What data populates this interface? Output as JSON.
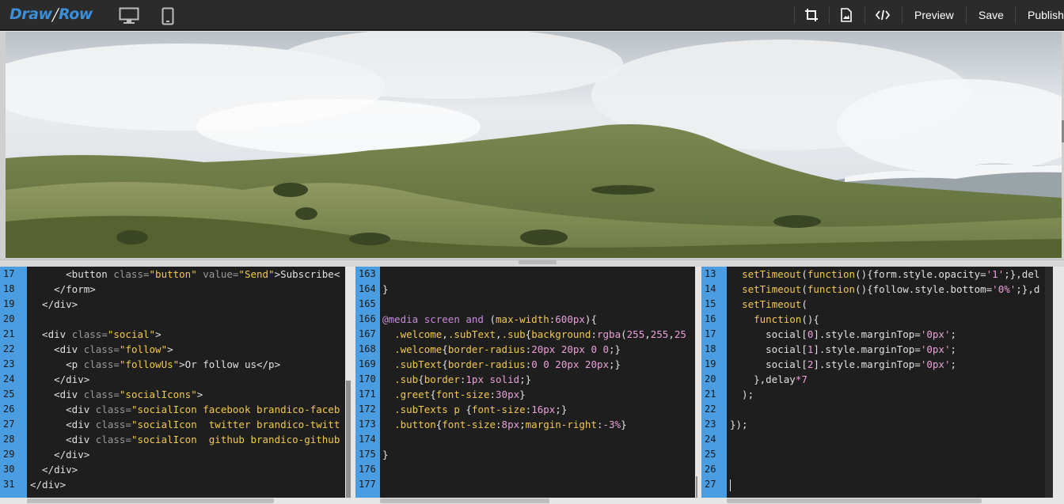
{
  "app": {
    "logo_left": "Draw",
    "logo_right": "Row"
  },
  "toolbar": {
    "devices": [
      "desktop-icon",
      "mobile-icon"
    ],
    "icons": [
      "crop-icon",
      "image-icon",
      "code-icon"
    ],
    "preview_label": "Preview",
    "save_label": "Save",
    "publish_label": "Publish"
  },
  "preview": {
    "sky_color": "#dfe3e8",
    "hill_color": "#6f7c4a"
  },
  "html_editor": {
    "line_numbers": [
      "17",
      "18",
      "19",
      "20",
      "21",
      "22",
      "23",
      "24",
      "25",
      "26",
      "27",
      "28",
      "29",
      "30",
      "31"
    ],
    "lines": [
      [
        {
          "c": "t",
          "v": "      <button "
        },
        {
          "c": "a",
          "v": "class="
        },
        {
          "c": "s",
          "v": "\"button\""
        },
        {
          "c": "t",
          "v": " "
        },
        {
          "c": "a",
          "v": "value="
        },
        {
          "c": "s",
          "v": "\"Send\""
        },
        {
          "c": "t",
          "v": ">Subscribe<"
        }
      ],
      [
        {
          "c": "t",
          "v": "    </form>"
        }
      ],
      [
        {
          "c": "t",
          "v": "  </div>"
        }
      ],
      [
        {
          "c": "t",
          "v": ""
        }
      ],
      [
        {
          "c": "t",
          "v": "  <div "
        },
        {
          "c": "a",
          "v": "class="
        },
        {
          "c": "s",
          "v": "\"social\""
        },
        {
          "c": "t",
          "v": ">"
        }
      ],
      [
        {
          "c": "t",
          "v": "    <div "
        },
        {
          "c": "a",
          "v": "class="
        },
        {
          "c": "s",
          "v": "\"follow\""
        },
        {
          "c": "t",
          "v": ">"
        }
      ],
      [
        {
          "c": "t",
          "v": "      <p "
        },
        {
          "c": "a",
          "v": "class="
        },
        {
          "c": "s",
          "v": "\"followUs\""
        },
        {
          "c": "t",
          "v": ">Or follow us</p>"
        }
      ],
      [
        {
          "c": "t",
          "v": "    </div>"
        }
      ],
      [
        {
          "c": "t",
          "v": "    <div "
        },
        {
          "c": "a",
          "v": "class="
        },
        {
          "c": "s",
          "v": "\"socialIcons\""
        },
        {
          "c": "t",
          "v": ">"
        }
      ],
      [
        {
          "c": "t",
          "v": "      <div "
        },
        {
          "c": "a",
          "v": "class="
        },
        {
          "c": "s",
          "v": "\"socialIcon facebook brandico-faceb"
        }
      ],
      [
        {
          "c": "t",
          "v": "      <div "
        },
        {
          "c": "a",
          "v": "class="
        },
        {
          "c": "s",
          "v": "\"socialIcon  twitter brandico-twitt"
        }
      ],
      [
        {
          "c": "t",
          "v": "      <div "
        },
        {
          "c": "a",
          "v": "class="
        },
        {
          "c": "s",
          "v": "\"socialIcon  github brandico-github"
        }
      ],
      [
        {
          "c": "t",
          "v": "    </div>"
        }
      ],
      [
        {
          "c": "t",
          "v": "  </div>"
        }
      ],
      [
        {
          "c": "t",
          "v": "</div>"
        }
      ]
    ]
  },
  "css_editor": {
    "line_numbers": [
      "163",
      "164",
      "165",
      "166",
      "167",
      "168",
      "169",
      "170",
      "171",
      "172",
      "173",
      "174",
      "175",
      "176",
      "177"
    ],
    "lines": [
      [
        {
          "c": "plain",
          "v": ""
        }
      ],
      [
        {
          "c": "plain",
          "v": "}"
        }
      ],
      [
        {
          "c": "plain",
          "v": ""
        }
      ],
      [
        {
          "c": "at",
          "v": "@media"
        },
        {
          "c": "plain",
          "v": " "
        },
        {
          "c": "at",
          "v": "screen"
        },
        {
          "c": "plain",
          "v": " "
        },
        {
          "c": "at",
          "v": "and"
        },
        {
          "c": "plain",
          "v": " ("
        },
        {
          "c": "prop",
          "v": "max-width"
        },
        {
          "c": "plain",
          "v": ":"
        },
        {
          "c": "num",
          "v": "600px"
        },
        {
          "c": "plain",
          "v": "){"
        }
      ],
      [
        {
          "c": "plain",
          "v": "  "
        },
        {
          "c": "sel",
          "v": ".welcome"
        },
        {
          "c": "plain",
          "v": ","
        },
        {
          "c": "sel",
          "v": ".subText"
        },
        {
          "c": "plain",
          "v": ","
        },
        {
          "c": "sel",
          "v": ".sub"
        },
        {
          "c": "plain",
          "v": "{"
        },
        {
          "c": "prop",
          "v": "background"
        },
        {
          "c": "plain",
          "v": ":"
        },
        {
          "c": "num",
          "v": "rgba"
        },
        {
          "c": "plain",
          "v": "("
        },
        {
          "c": "num",
          "v": "255"
        },
        {
          "c": "plain",
          "v": ","
        },
        {
          "c": "num",
          "v": "255"
        },
        {
          "c": "plain",
          "v": ","
        },
        {
          "c": "num",
          "v": "25"
        }
      ],
      [
        {
          "c": "plain",
          "v": "  "
        },
        {
          "c": "sel",
          "v": ".welcome"
        },
        {
          "c": "plain",
          "v": "{"
        },
        {
          "c": "prop",
          "v": "border-radius"
        },
        {
          "c": "plain",
          "v": ":"
        },
        {
          "c": "num",
          "v": "20px 20px 0 0"
        },
        {
          "c": "plain",
          "v": ";}"
        }
      ],
      [
        {
          "c": "plain",
          "v": "  "
        },
        {
          "c": "sel",
          "v": ".subText"
        },
        {
          "c": "plain",
          "v": "{"
        },
        {
          "c": "prop",
          "v": "border-radius"
        },
        {
          "c": "plain",
          "v": ":"
        },
        {
          "c": "num",
          "v": "0 0 20px 20px"
        },
        {
          "c": "plain",
          "v": ";}"
        }
      ],
      [
        {
          "c": "plain",
          "v": "  "
        },
        {
          "c": "sel",
          "v": ".sub"
        },
        {
          "c": "plain",
          "v": "{"
        },
        {
          "c": "prop",
          "v": "border"
        },
        {
          "c": "plain",
          "v": ":"
        },
        {
          "c": "num",
          "v": "1px solid"
        },
        {
          "c": "plain",
          "v": ";}"
        }
      ],
      [
        {
          "c": "plain",
          "v": "  "
        },
        {
          "c": "sel",
          "v": ".greet"
        },
        {
          "c": "plain",
          "v": "{"
        },
        {
          "c": "prop",
          "v": "font-size"
        },
        {
          "c": "plain",
          "v": ":"
        },
        {
          "c": "num",
          "v": "30px"
        },
        {
          "c": "plain",
          "v": "}"
        }
      ],
      [
        {
          "c": "plain",
          "v": "  "
        },
        {
          "c": "sel",
          "v": ".subTexts p"
        },
        {
          "c": "plain",
          "v": " {"
        },
        {
          "c": "prop",
          "v": "font-size"
        },
        {
          "c": "plain",
          "v": ":"
        },
        {
          "c": "num",
          "v": "16px"
        },
        {
          "c": "plain",
          "v": ";}"
        }
      ],
      [
        {
          "c": "plain",
          "v": "  "
        },
        {
          "c": "sel",
          "v": ".button"
        },
        {
          "c": "plain",
          "v": "{"
        },
        {
          "c": "prop",
          "v": "font-size"
        },
        {
          "c": "plain",
          "v": ":"
        },
        {
          "c": "num",
          "v": "8px"
        },
        {
          "c": "plain",
          "v": ";"
        },
        {
          "c": "prop",
          "v": "margin-right"
        },
        {
          "c": "plain",
          "v": ":"
        },
        {
          "c": "num",
          "v": "-3%"
        },
        {
          "c": "plain",
          "v": "}"
        }
      ],
      [
        {
          "c": "plain",
          "v": ""
        }
      ],
      [
        {
          "c": "plain",
          "v": "}"
        }
      ],
      [
        {
          "c": "plain",
          "v": ""
        }
      ],
      [
        {
          "c": "plain",
          "v": ""
        }
      ]
    ]
  },
  "js_editor": {
    "line_numbers": [
      "13",
      "14",
      "15",
      "16",
      "17",
      "18",
      "19",
      "20",
      "21",
      "22",
      "23",
      "24",
      "25",
      "26",
      "27"
    ],
    "lines": [
      [
        {
          "c": "plain",
          "v": "  "
        },
        {
          "c": "fn",
          "v": "setTimeout"
        },
        {
          "c": "plain",
          "v": "("
        },
        {
          "c": "fn",
          "v": "function"
        },
        {
          "c": "plain",
          "v": "(){form.style.opacity="
        },
        {
          "c": "str",
          "v": "'1'"
        },
        {
          "c": "plain",
          "v": ";},del"
        }
      ],
      [
        {
          "c": "plain",
          "v": "  "
        },
        {
          "c": "fn",
          "v": "setTimeout"
        },
        {
          "c": "plain",
          "v": "("
        },
        {
          "c": "fn",
          "v": "function"
        },
        {
          "c": "plain",
          "v": "(){follow.style.bottom="
        },
        {
          "c": "str",
          "v": "'0%'"
        },
        {
          "c": "plain",
          "v": ";},d"
        }
      ],
      [
        {
          "c": "plain",
          "v": "  "
        },
        {
          "c": "fn",
          "v": "setTimeout"
        },
        {
          "c": "plain",
          "v": "("
        }
      ],
      [
        {
          "c": "plain",
          "v": "    "
        },
        {
          "c": "fn",
          "v": "function"
        },
        {
          "c": "plain",
          "v": "(){"
        }
      ],
      [
        {
          "c": "plain",
          "v": "      social["
        },
        {
          "c": "num",
          "v": "0"
        },
        {
          "c": "plain",
          "v": "].style.marginTop="
        },
        {
          "c": "str",
          "v": "'0px'"
        },
        {
          "c": "plain",
          "v": ";"
        }
      ],
      [
        {
          "c": "plain",
          "v": "      social["
        },
        {
          "c": "num",
          "v": "1"
        },
        {
          "c": "plain",
          "v": "].style.marginTop="
        },
        {
          "c": "str",
          "v": "'0px'"
        },
        {
          "c": "plain",
          "v": ";"
        }
      ],
      [
        {
          "c": "plain",
          "v": "      social["
        },
        {
          "c": "num",
          "v": "2"
        },
        {
          "c": "plain",
          "v": "].style.marginTop="
        },
        {
          "c": "str",
          "v": "'0px'"
        },
        {
          "c": "plain",
          "v": ";"
        }
      ],
      [
        {
          "c": "plain",
          "v": "    },delay"
        },
        {
          "c": "str",
          "v": "*7"
        }
      ],
      [
        {
          "c": "plain",
          "v": "  );"
        }
      ],
      [
        {
          "c": "plain",
          "v": ""
        }
      ],
      [
        {
          "c": "plain",
          "v": "});"
        }
      ],
      [
        {
          "c": "plain",
          "v": ""
        }
      ],
      [
        {
          "c": "plain",
          "v": ""
        }
      ],
      [
        {
          "c": "plain",
          "v": ""
        }
      ],
      [
        {
          "c": "plain",
          "v": ""
        }
      ]
    ]
  }
}
